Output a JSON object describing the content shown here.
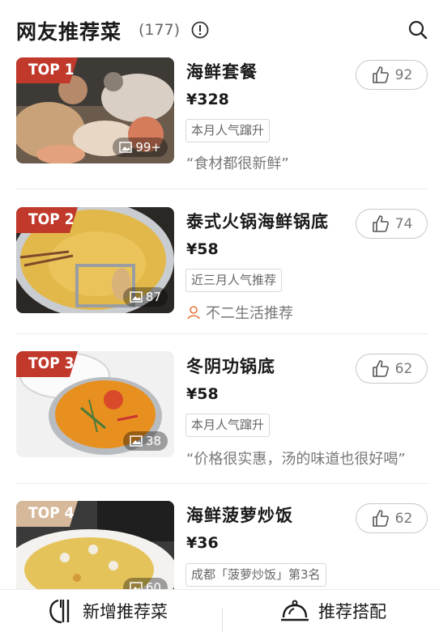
{
  "header": {
    "title": "网友推荐菜",
    "count": "(177)",
    "info_icon": "info-circle-icon",
    "search_icon": "search-icon"
  },
  "items": [
    {
      "rank": "TOP 1",
      "name": "海鲜套餐",
      "price": "¥328",
      "tag": "本月人气蹿升",
      "quote": "“食材都很新鲜”",
      "photos": "99+",
      "likes": "92"
    },
    {
      "rank": "TOP 2",
      "name": "泰式火锅海鲜锅底",
      "price": "¥58",
      "tag": "近三月人气推荐",
      "recommender": "不二生活推荐",
      "photos": "87",
      "likes": "74"
    },
    {
      "rank": "TOP 3",
      "name": "冬阴功锅底",
      "price": "¥58",
      "tag": "本月人气蹿升",
      "quote": "“价格很实惠，汤的味道也很好喝”",
      "photos": "38",
      "likes": "62"
    },
    {
      "rank": "TOP 4",
      "name": "海鲜菠萝炒饭",
      "price": "¥36",
      "tag": "成都「菠萝炒饭」第3名",
      "photos": "60",
      "likes": "62"
    }
  ],
  "bottom_bar": {
    "add_label": "新增推荐菜",
    "combo_label": "推荐搭配"
  },
  "colors": {
    "badge_top3": "#c0392b",
    "badge_top4": "#d6b89a",
    "accent": "#e8763a"
  }
}
